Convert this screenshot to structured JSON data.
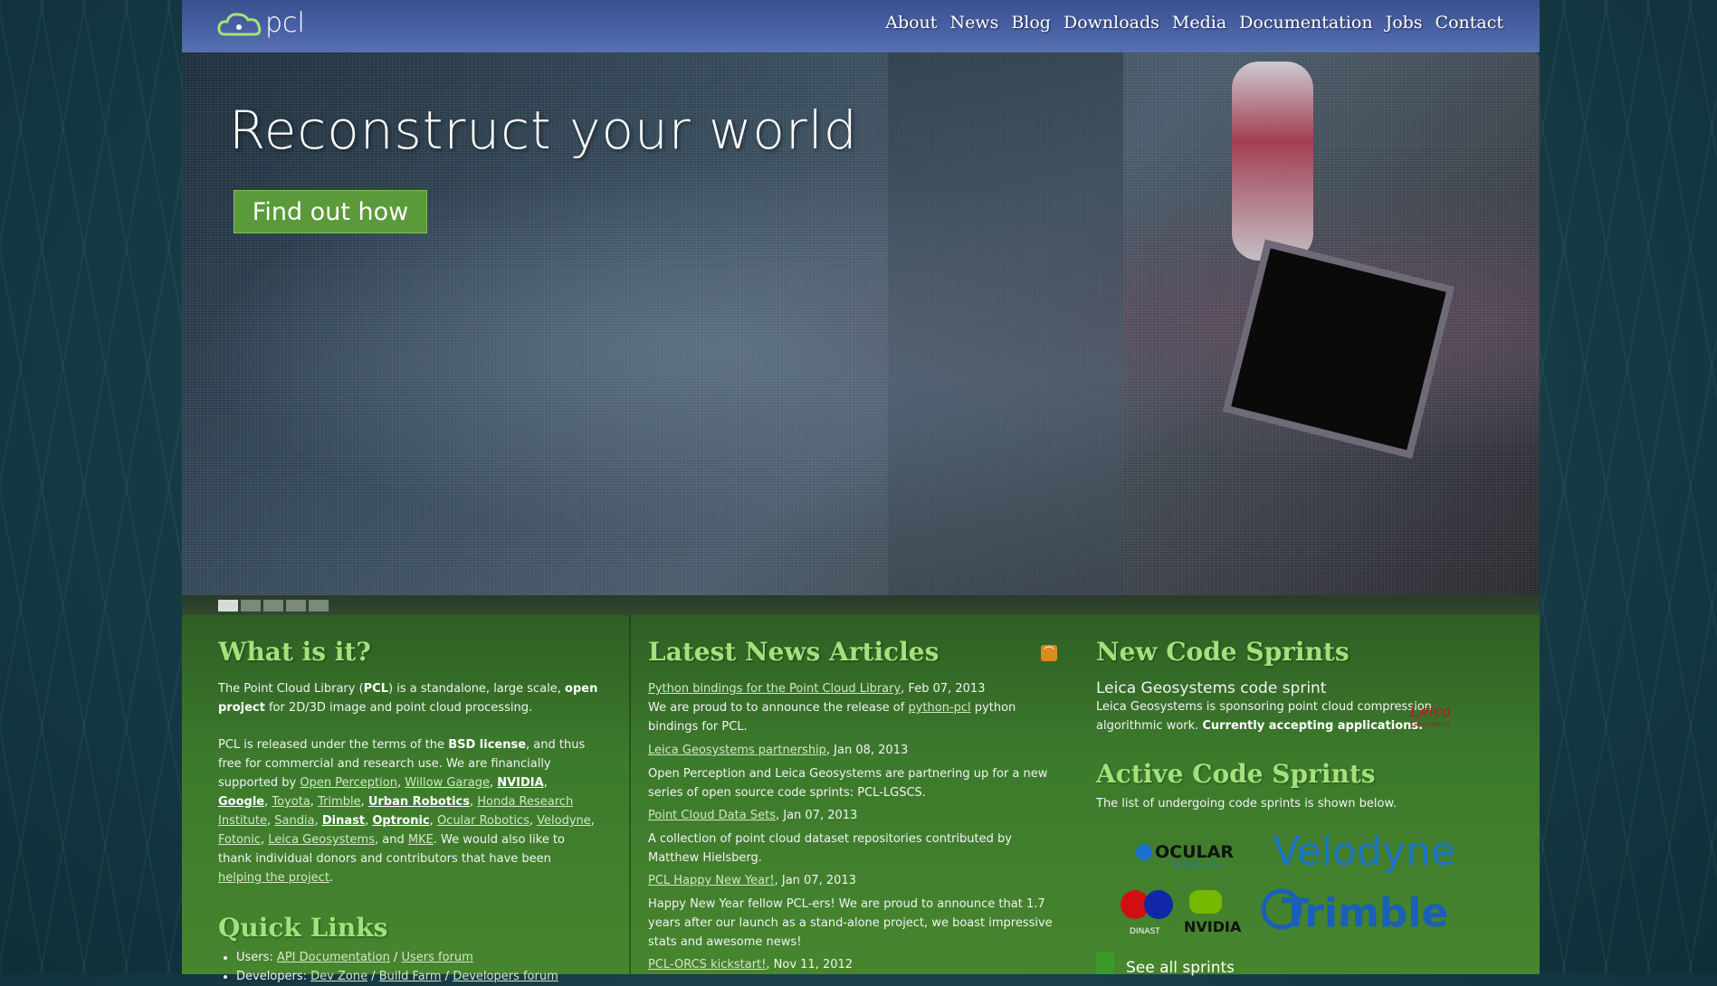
{
  "header": {
    "logo_text": "pcl",
    "nav": [
      "About",
      "News",
      "Blog",
      "Downloads",
      "Media",
      "Documentation",
      "Jobs",
      "Contact"
    ]
  },
  "hero": {
    "title": "Reconstruct your world",
    "button": "Find out how",
    "slides": 5,
    "active_slide": 1
  },
  "what": {
    "heading": "What is it?",
    "p1_a": "The Point Cloud Library (",
    "p1_b": "PCL",
    "p1_c": ") is a standalone, large scale, ",
    "p1_d": "open project",
    "p1_e": " for 2D/3D image and point cloud processing.",
    "p2_a": "PCL is released under the terms of the ",
    "p2_b": "BSD license",
    "p2_c": ", and thus free for commercial and research use. We are financially supported by ",
    "supporters": [
      "Open Perception",
      "Willow Garage",
      "NVIDIA",
      "Google",
      "Toyota",
      "Trimble",
      "Urban Robotics",
      "Honda Research Institute",
      "Sandia",
      "Dinast",
      "Optronic",
      "Ocular Robotics",
      "Velodyne",
      "Fotonic",
      "Leica Geosystems"
    ],
    "and": "and ",
    "mke": "MKE",
    "p2_d": ". We would also like to thank individual donors and contributors that have been ",
    "helping": "helping the project",
    "p2_e": "."
  },
  "quick": {
    "heading": "Quick Links",
    "users_label": "Users: ",
    "users_links": [
      "API Documentation",
      "Users forum"
    ],
    "dev_label": "Developers: ",
    "dev_links": [
      "Dev Zone",
      "Build Farm",
      "Developers forum"
    ],
    "sep": " / "
  },
  "news": {
    "heading": "Latest News Articles",
    "items": [
      {
        "title": "Python bindings for the Point Cloud Library",
        "date": ", Feb 07, 2013"
      },
      {
        "title": "Leica Geosystems partnership",
        "date": ", Jan 08, 2013"
      },
      {
        "title": "Point Cloud Data Sets",
        "date": ", Jan 07, 2013"
      },
      {
        "title": "PCL Happy New Year!",
        "date": ", Jan 07, 2013"
      },
      {
        "title": "PCL-ORCS kickstart!",
        "date": ", Nov 11, 2012"
      }
    ],
    "d1_a": "We are proud to to announce the release of ",
    "d1_link": "python-pcl",
    "d1_b": " python bindings for PCL.",
    "d2": "Open Perception and Leica Geosystems are partnering up for a new series of open source code sprints: PCL-LGSCS.",
    "d3": "A collection of point cloud dataset repositories contributed by Matthew Hielsberg.",
    "d4": "Happy New Year fellow PCL-ers! We are proud to announce that 1.7 years after our launch as a stand-alone project, we boast impressive stats and awesome news!"
  },
  "sprints": {
    "heading": "New Code Sprints",
    "sprint_title": "Leica Geosystems code sprint",
    "sprint_a": "Leica Geosystems is sponsoring point cloud compression algorithmic work. ",
    "sprint_b": "Currently accepting applications.",
    "active_heading": "Active Code Sprints",
    "active_text": "The list of undergoing code sprints is shown below.",
    "logo_ocular": "OCULAR",
    "logo_ocular_sub": "ROBOTICS",
    "logo_velodyne": "Velodyne",
    "logo_dinast": "DINAST",
    "logo_nvidia": "NVIDIA",
    "logo_trimble": "Trimble",
    "logo_leica": "Leica",
    "logo_leica_sub": "Geosystems",
    "see_all": "See all sprints"
  }
}
